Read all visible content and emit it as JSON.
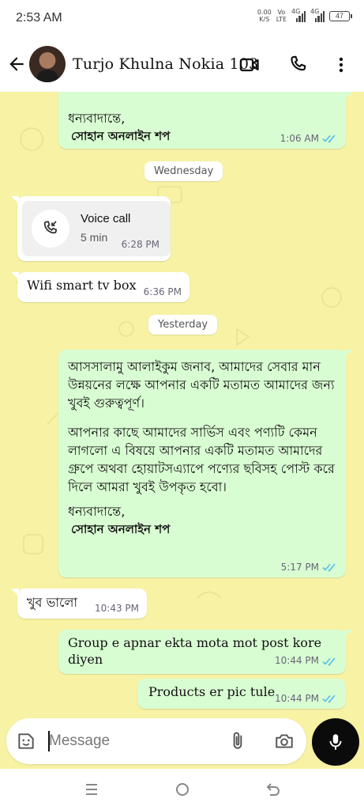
{
  "status_bar": {
    "time": "2:53 AM",
    "net_speed_value": "0.00",
    "net_speed_unit": "K/S",
    "volte_top": "Vo",
    "volte_bottom": "LTE",
    "sig1": "4G",
    "sig2": "4G",
    "battery": "47"
  },
  "header": {
    "contact_name": "Turjo Khulna Nokia 103"
  },
  "messages": {
    "m1_line1": "ধন্যবাদান্তে,",
    "m1_line2": "সোহান অনলাইন শপ",
    "m1_time": "1:06 AM",
    "date1": "Wednesday",
    "call_title": "Voice call",
    "call_duration": "5 min",
    "call_time": "6:28 PM",
    "m3_text": "Wifi smart tv box",
    "m3_time": "6:36 PM",
    "date2": "Yesterday",
    "m4_p1": "আসসালামু আলাইকুম জনাব, আমাদের সেবার মান উন্নয়নের লক্ষে আপনার একটি মতামত আমাদের জন্য খুবই গুরুত্বপূর্ণ।",
    "m4_p2": "আপনার কাছে আমাদের সার্ভিস এবং পণ্যটি কেমন লাগলো এ বিষয়ে আপনার একটি মতামত আমাদের গ্রুপে অথবা হোয়াটসএ্যাপে পণ্যের ছবিসহ পোস্ট করে দিলে আমরা খুবই উপকৃত হবো।",
    "m4_p3": "ধন্যবাদান্তে,",
    "m4_sign": "সোহান অনলাইন শপ",
    "m4_time": "5:17 PM",
    "m5_text": "খুব ভালো",
    "m5_time": "10:43 PM",
    "m6_text": "Group e apnar ekta mota mot post kore diyen",
    "m6_time": "10:44 PM",
    "m7_text": "Products er pic tule",
    "m7_time": "10:44 PM"
  },
  "input": {
    "placeholder": "Message"
  },
  "colors": {
    "chat_bg": "#f7f2a4",
    "outgoing": "#d9fdd3",
    "incoming": "#ffffff",
    "read_ticks": "#53bdeb"
  },
  "icons": [
    "back-arrow-icon",
    "video-call-icon",
    "phone-icon",
    "more-vert-icon",
    "missed-call-icon",
    "sticker-icon",
    "attach-icon",
    "camera-icon",
    "mic-icon",
    "nav-menu-icon",
    "nav-home-icon",
    "nav-back-icon"
  ]
}
